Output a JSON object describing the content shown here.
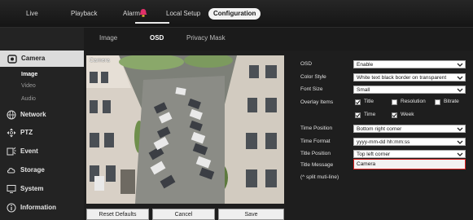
{
  "topnav": {
    "live": "Live",
    "playback": "Playback",
    "alarm": "Alarm",
    "local_setup": "Local Setup",
    "configuration": "Configuration"
  },
  "tabs": {
    "image": "Image",
    "osd": "OSD",
    "privacy_mask": "Privacy Mask"
  },
  "sidebar": {
    "camera": "Camera",
    "image": "Image",
    "video": "Video",
    "audio": "Audio",
    "network": "Network",
    "ptz": "PTZ",
    "event": "Event",
    "storage": "Storage",
    "system": "System",
    "information": "Information"
  },
  "form": {
    "osd_label": "OSD",
    "osd_value": "Enable",
    "color_style_label": "Color Style",
    "color_style_value": "White text black border on transparent",
    "font_size_label": "Font Size",
    "font_size_value": "Small",
    "overlay_items_label": "Overlay Items",
    "overlay": {
      "title": "Title",
      "resolution": "Resolution",
      "bitrate": "Bitrate",
      "time": "Time",
      "week": "Week"
    },
    "time_position_label": "Time Position",
    "time_position_value": "Bottom right corner",
    "time_format_label": "Time Format",
    "time_format_value": "yyyy-mm-dd hh:mm:ss",
    "title_position_label": "Title Position",
    "title_position_value": "Top left corner",
    "title_message_label": "Title Message",
    "title_message_value": "Camera",
    "split_hint": "(^ split muti-line)"
  },
  "buttons": {
    "reset": "Reset Defaults",
    "cancel": "Cancel",
    "save": "Save"
  },
  "colors": {
    "alarm_badge": "#e0306a",
    "invalid_border": "#dd2222"
  }
}
